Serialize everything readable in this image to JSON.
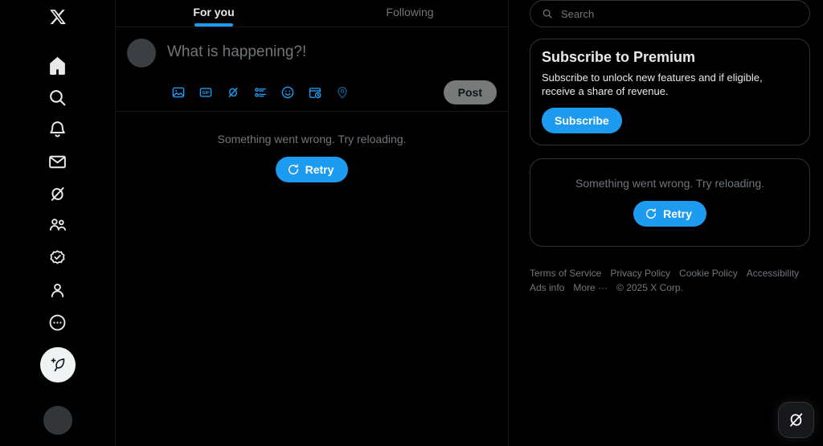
{
  "colors": {
    "background": "#000000",
    "accent": "#1d9bf0",
    "border": "#2f3336",
    "muted_text": "#71767b",
    "primary_text": "#e7e9ea",
    "disabled_button": "#787a7a"
  },
  "sidebar": {
    "logo": "x-logo",
    "items": [
      {
        "name": "home",
        "icon": "home-icon"
      },
      {
        "name": "explore",
        "icon": "search-icon"
      },
      {
        "name": "notifications",
        "icon": "bell-icon"
      },
      {
        "name": "messages",
        "icon": "envelope-icon"
      },
      {
        "name": "grok",
        "icon": "grok-icon"
      },
      {
        "name": "communities",
        "icon": "communities-icon"
      },
      {
        "name": "premium",
        "icon": "verified-badge-icon"
      },
      {
        "name": "profile",
        "icon": "person-icon"
      },
      {
        "name": "more",
        "icon": "more-circle-icon"
      }
    ],
    "compose_button": "compose-post-icon",
    "account_avatar": "account-avatar"
  },
  "main": {
    "tabs": [
      {
        "label": "For you",
        "active": true
      },
      {
        "label": "Following",
        "active": false
      }
    ],
    "composer": {
      "placeholder": "What is happening?!",
      "value": "",
      "post_label": "Post",
      "tools": [
        {
          "name": "media-image-icon"
        },
        {
          "name": "gif-icon"
        },
        {
          "name": "grok-image-icon"
        },
        {
          "name": "poll-icon"
        },
        {
          "name": "emoji-icon"
        },
        {
          "name": "schedule-icon"
        },
        {
          "name": "location-icon"
        }
      ]
    },
    "error": {
      "message": "Something went wrong. Try reloading.",
      "retry_label": "Retry"
    }
  },
  "right": {
    "search": {
      "placeholder": "Search"
    },
    "premium_card": {
      "title": "Subscribe to Premium",
      "body": "Subscribe to unlock new features and if eligible, receive a share of revenue.",
      "button_label": "Subscribe"
    },
    "error_card": {
      "message": "Something went wrong. Try reloading.",
      "retry_label": "Retry"
    },
    "footer": {
      "links": [
        "Terms of Service",
        "Privacy Policy",
        "Cookie Policy",
        "Accessibility",
        "Ads info",
        "More ···"
      ],
      "copyright": "© 2025 X Corp."
    }
  },
  "floating": {
    "grok_button": "grok-icon"
  }
}
